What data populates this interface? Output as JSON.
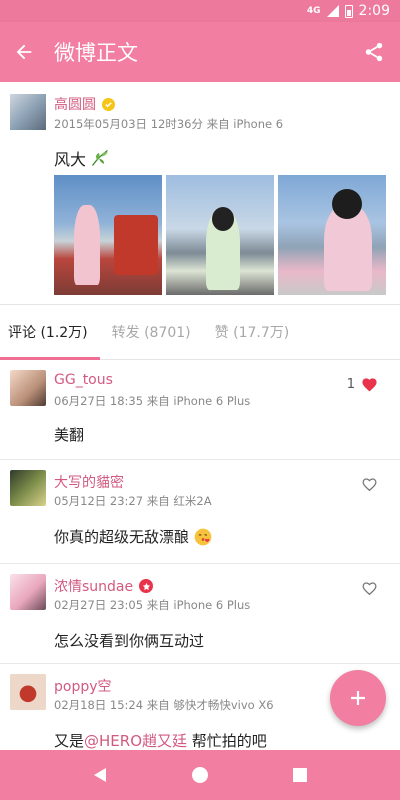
{
  "status_bar": {
    "network": "4G",
    "time": "2:09"
  },
  "app_bar": {
    "title": "微博正文",
    "back_icon": "arrow-back-icon",
    "share_icon": "share-icon"
  },
  "post": {
    "user_name": "高圆圆",
    "meta": "2015年05月03日 12时36分 来自 iPhone 6",
    "text": "风大",
    "emoji_icon": "bamboo-leaf-icon",
    "photo_count": 3
  },
  "tabs": [
    {
      "label": "评论 (1.2万)"
    },
    {
      "label": "转发 (8701)"
    },
    {
      "label": "赞 (17.7万)"
    }
  ],
  "comments": [
    {
      "user": "GG_tous",
      "meta": "06月27日 18:35 来自 iPhone 6 Plus",
      "text": "美翻",
      "likes": "1",
      "liked": true
    },
    {
      "user": "大写的貓密",
      "meta": "05月12日 23:27 来自 红米2A",
      "text": "你真的超级无敌漂酿",
      "liked": false
    },
    {
      "user": "浓情sundae",
      "meta": "02月27日 23:05 来自 iPhone 6 Plus",
      "text": "怎么没看到你俩互动过",
      "liked": false
    },
    {
      "user": "poppy空",
      "meta": "02月18日 15:24 来自 够快才畅快vivo X6",
      "text_prefix": "又是",
      "mention": "@HERO趙又廷",
      "text_suffix": " 帮忙拍的吧"
    }
  ],
  "fab": {
    "icon": "plus-icon"
  },
  "colors": {
    "accent": "#f27ea1",
    "name": "#d25a80",
    "heart": "#e8334a"
  }
}
